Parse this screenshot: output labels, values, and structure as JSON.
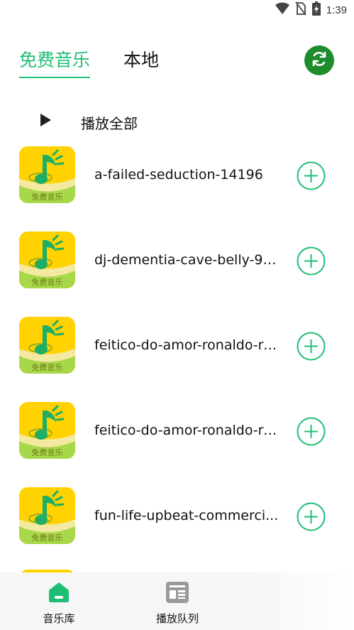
{
  "status_bar": {
    "time": "1:39",
    "icons": [
      "wifi-icon",
      "no-sim-icon",
      "battery-charging-icon"
    ]
  },
  "header": {
    "tabs": [
      {
        "label": "免费音乐",
        "active": true
      },
      {
        "label": "本地",
        "active": false
      }
    ],
    "refresh_icon": "refresh-icon"
  },
  "play_all": {
    "label": "播放全部"
  },
  "cover": {
    "caption": "免费音乐"
  },
  "songs": [
    {
      "title": "a-failed-seduction-14196"
    },
    {
      "title": "dj-dementia-cave-belly-95..."
    },
    {
      "title": "feitico-do-amor-ronaldo-re..."
    },
    {
      "title": "feitico-do-amor-ronaldo-re..."
    },
    {
      "title": "fun-life-upbeat-commerci..."
    }
  ],
  "bottom_nav": [
    {
      "label": "音乐库",
      "icon": "home-icon",
      "active": true
    },
    {
      "label": "播放队列",
      "icon": "queue-icon",
      "active": false
    }
  ],
  "colors": {
    "accent": "#1fbe75",
    "refresh_bg": "#1c8c2c",
    "cover_yellow": "#ffd700"
  }
}
